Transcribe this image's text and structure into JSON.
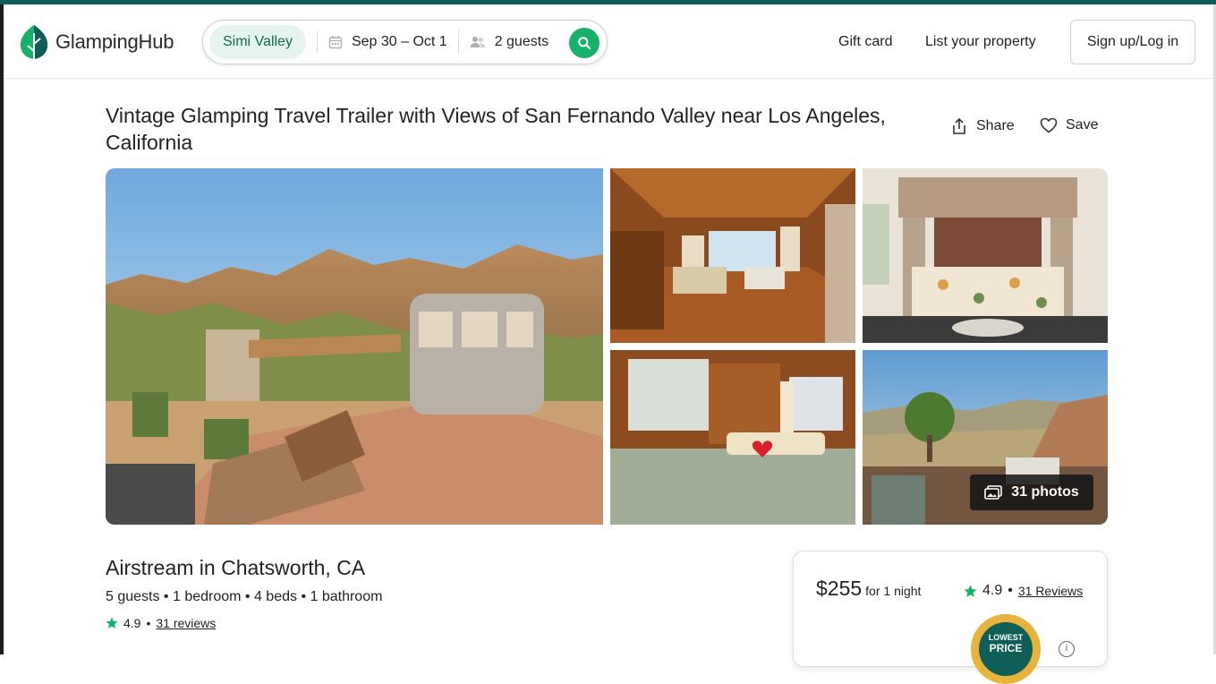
{
  "brand": {
    "name": "GlampingHub",
    "accent": "#17b26a",
    "dark": "#0f5e57"
  },
  "search": {
    "location": "Simi Valley",
    "dates": "Sep 30 – Oct 1",
    "guests": "2 guests"
  },
  "nav": {
    "gift_card": "Gift card",
    "list_property": "List your property",
    "signup": "Sign up/Log in"
  },
  "listing": {
    "title": "Vintage Glamping Travel Trailer with Views of San Fernando Valley near Los Angeles, California",
    "share": "Share",
    "save": "Save",
    "photos_label": "31 photos",
    "subtitle": "Airstream in Chatsworth, CA",
    "specs": "5 guests • 1 bedroom • 4 beds • 1 bathroom",
    "rating": "4.9",
    "reviews_link": "31 reviews"
  },
  "booking": {
    "price": "$255",
    "per": "for 1 night",
    "rating": "4.9",
    "dot": "•",
    "reviews_link": "31 Reviews",
    "seal_top": "LOWEST",
    "seal_bottom": "PRICE",
    "info": "i"
  }
}
